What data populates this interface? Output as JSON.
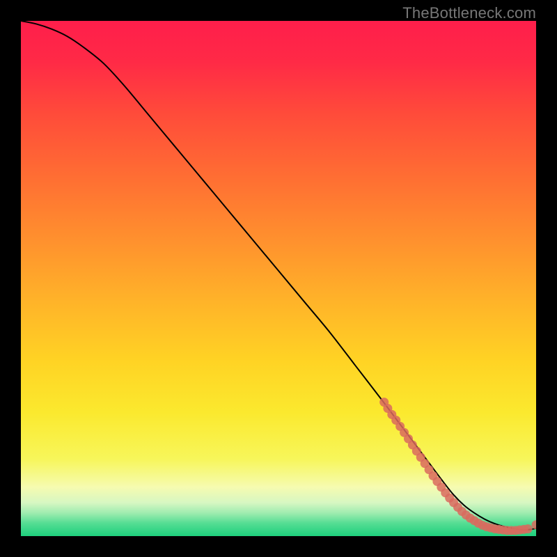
{
  "watermark": "TheBottleneck.com",
  "chart_data": {
    "type": "line",
    "title": "",
    "xlabel": "",
    "ylabel": "",
    "xlim": [
      0,
      100
    ],
    "ylim": [
      0,
      100
    ],
    "grid": false,
    "legend": false,
    "background_gradient": {
      "stops": [
        {
          "offset": 0.0,
          "color": "#ff1e4b"
        },
        {
          "offset": 0.08,
          "color": "#ff2a46"
        },
        {
          "offset": 0.18,
          "color": "#ff4b3a"
        },
        {
          "offset": 0.3,
          "color": "#ff6d33"
        },
        {
          "offset": 0.42,
          "color": "#ff8f2e"
        },
        {
          "offset": 0.54,
          "color": "#ffb229"
        },
        {
          "offset": 0.66,
          "color": "#ffd324"
        },
        {
          "offset": 0.76,
          "color": "#fbe92e"
        },
        {
          "offset": 0.85,
          "color": "#f7f65a"
        },
        {
          "offset": 0.905,
          "color": "#f6fbb0"
        },
        {
          "offset": 0.935,
          "color": "#d7f7c2"
        },
        {
          "offset": 0.955,
          "color": "#9fecb0"
        },
        {
          "offset": 0.975,
          "color": "#55dd93"
        },
        {
          "offset": 1.0,
          "color": "#1ed07d"
        }
      ]
    },
    "series": [
      {
        "name": "bottleneck-curve",
        "color": "#000000",
        "x": [
          0,
          3,
          6,
          9,
          12,
          16,
          20,
          25,
          30,
          35,
          40,
          45,
          50,
          55,
          60,
          65,
          70,
          73,
          76,
          79,
          82,
          84,
          86,
          88,
          90,
          92,
          94,
          96,
          98,
          100
        ],
        "y": [
          100,
          99.4,
          98.4,
          97.0,
          95.0,
          91.8,
          87.5,
          81.5,
          75.5,
          69.5,
          63.5,
          57.5,
          51.5,
          45.5,
          39.5,
          33.0,
          26.5,
          22.5,
          18.5,
          14.5,
          10.5,
          8.0,
          6.0,
          4.5,
          3.3,
          2.4,
          1.8,
          1.4,
          1.2,
          1.5
        ]
      }
    ],
    "markers": [
      {
        "name": "scatter-cluster",
        "color": "#d96a5e",
        "points": [
          {
            "x": 70.5,
            "y": 26.0
          },
          {
            "x": 71.2,
            "y": 24.8
          },
          {
            "x": 72.0,
            "y": 23.6
          },
          {
            "x": 72.8,
            "y": 22.5
          },
          {
            "x": 73.6,
            "y": 21.3
          },
          {
            "x": 74.4,
            "y": 20.1
          },
          {
            "x": 75.2,
            "y": 18.9
          },
          {
            "x": 76.0,
            "y": 17.7
          },
          {
            "x": 76.8,
            "y": 16.5
          },
          {
            "x": 77.6,
            "y": 15.3
          },
          {
            "x": 78.4,
            "y": 14.1
          },
          {
            "x": 79.2,
            "y": 12.9
          },
          {
            "x": 80.0,
            "y": 11.7
          },
          {
            "x": 80.8,
            "y": 10.6
          },
          {
            "x": 81.6,
            "y": 9.5
          },
          {
            "x": 82.4,
            "y": 8.4
          },
          {
            "x": 83.2,
            "y": 7.4
          },
          {
            "x": 84.0,
            "y": 6.5
          },
          {
            "x": 84.8,
            "y": 5.6
          },
          {
            "x": 85.6,
            "y": 4.8
          },
          {
            "x": 86.4,
            "y": 4.1
          },
          {
            "x": 87.2,
            "y": 3.5
          },
          {
            "x": 88.0,
            "y": 3.0
          },
          {
            "x": 88.8,
            "y": 2.5
          },
          {
            "x": 89.6,
            "y": 2.1
          },
          {
            "x": 90.4,
            "y": 1.8
          },
          {
            "x": 91.2,
            "y": 1.6
          },
          {
            "x": 92.0,
            "y": 1.4
          },
          {
            "x": 92.8,
            "y": 1.3
          },
          {
            "x": 93.6,
            "y": 1.2
          },
          {
            "x": 94.4,
            "y": 1.1
          },
          {
            "x": 95.2,
            "y": 1.1
          },
          {
            "x": 96.0,
            "y": 1.1
          },
          {
            "x": 96.8,
            "y": 1.2
          },
          {
            "x": 97.6,
            "y": 1.3
          },
          {
            "x": 98.4,
            "y": 1.4
          },
          {
            "x": 100.0,
            "y": 2.2
          }
        ]
      }
    ]
  }
}
